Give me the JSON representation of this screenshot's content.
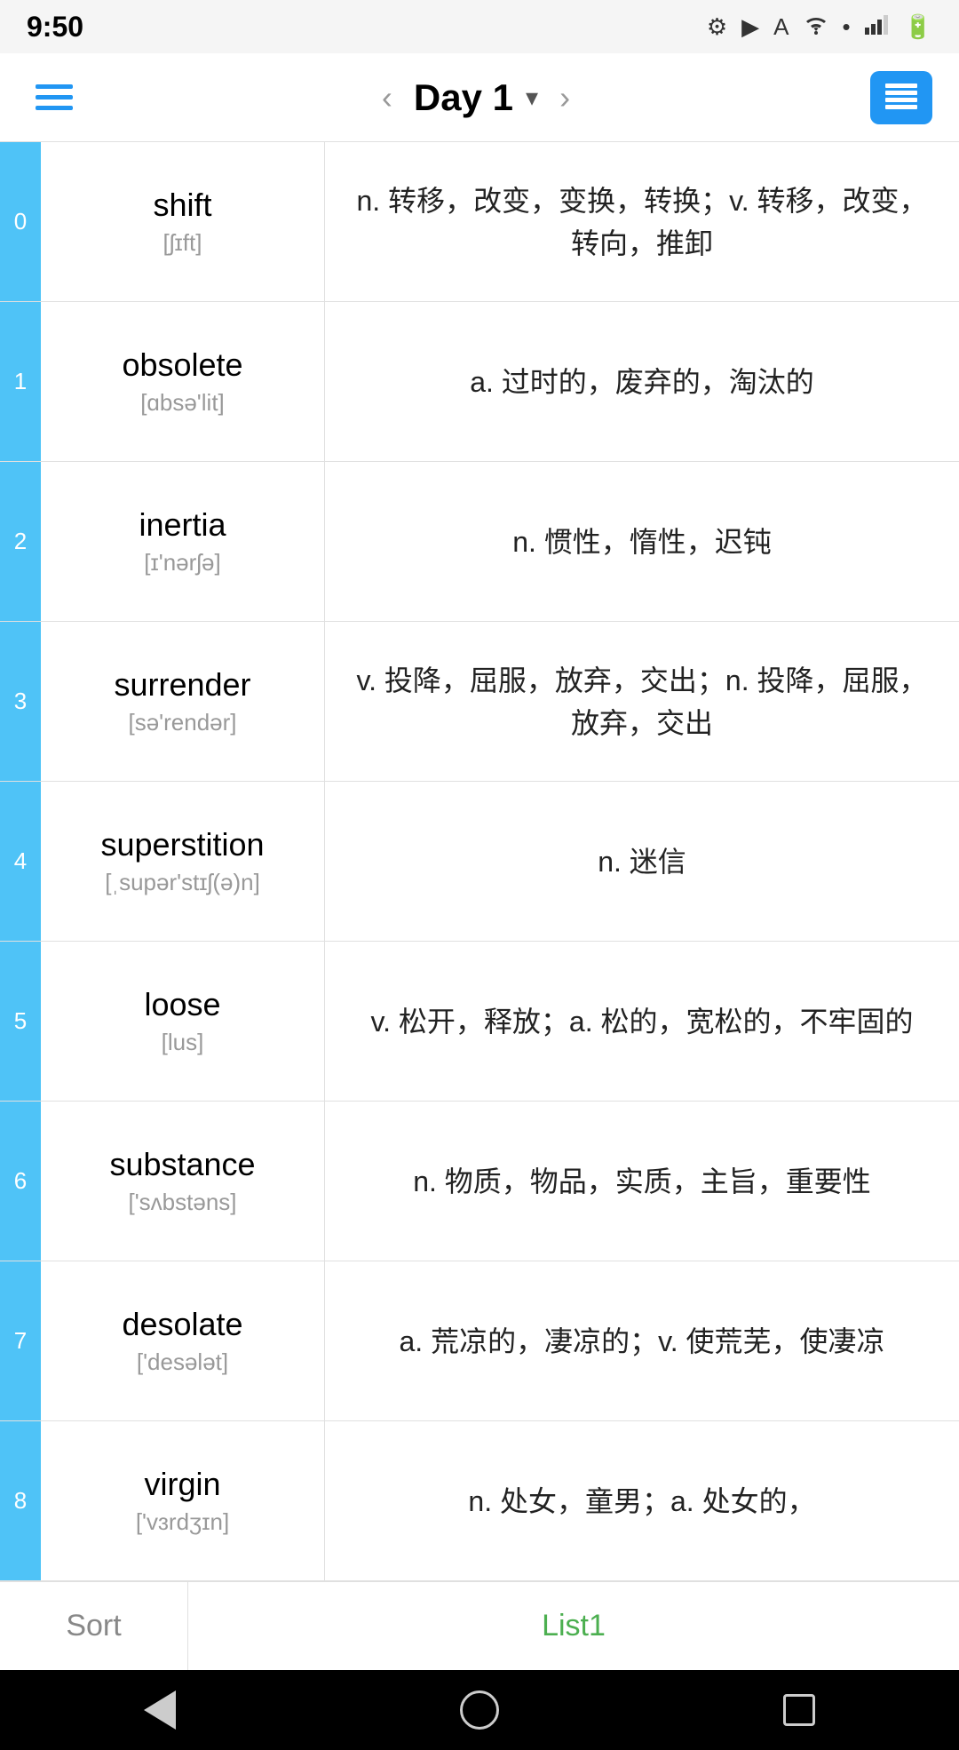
{
  "statusBar": {
    "time": "9:50",
    "icons": [
      "gear",
      "play",
      "A",
      "wifi",
      "dot",
      "signal",
      "battery"
    ]
  },
  "navBar": {
    "menuLabel": "menu",
    "prevArrow": "‹",
    "title": "Day 1",
    "dropdownArrow": "∨",
    "nextArrow": "›"
  },
  "words": [
    {
      "index": "0",
      "word": "shift",
      "phonetic": "[ʃɪft]",
      "definition": "n. 转移，改变，变换，转换；v. 转移，改变，转向，推卸"
    },
    {
      "index": "1",
      "word": "obsolete",
      "phonetic": "[ɑbsə'lit]",
      "definition": "a. 过时的，废弃的，淘汰的"
    },
    {
      "index": "2",
      "word": "inertia",
      "phonetic": "[ɪ'nərʃə]",
      "definition": "n. 惯性，惰性，迟钝"
    },
    {
      "index": "3",
      "word": "surrender",
      "phonetic": "[sə'rendər]",
      "definition": "v. 投降，屈服，放弃，交出；n. 投降，屈服，放弃，交出"
    },
    {
      "index": "4",
      "word": "superstition",
      "phonetic": "[ˌsupər'stɪʃ(ə)n]",
      "definition": "n. 迷信"
    },
    {
      "index": "5",
      "word": "loose",
      "phonetic": "[lus]",
      "definition": "v. 松开，释放；a. 松的，宽松的，不牢固的"
    },
    {
      "index": "6",
      "word": "substance",
      "phonetic": "['sʌbstəns]",
      "definition": "n. 物质，物品，实质，主旨，重要性"
    },
    {
      "index": "7",
      "word": "desolate",
      "phonetic": "['desələt]",
      "definition": "a. 荒凉的，凄凉的；v. 使荒芜，使凄凉"
    },
    {
      "index": "8",
      "word": "virgin",
      "phonetic": "['vɜrdʒɪn]",
      "definition": "n. 处女，童男；a. 处女的，"
    }
  ],
  "bottomTabs": {
    "sortLabel": "Sort",
    "list1Label": "List1"
  },
  "androidNav": {
    "back": "back",
    "home": "home",
    "recent": "recent"
  }
}
